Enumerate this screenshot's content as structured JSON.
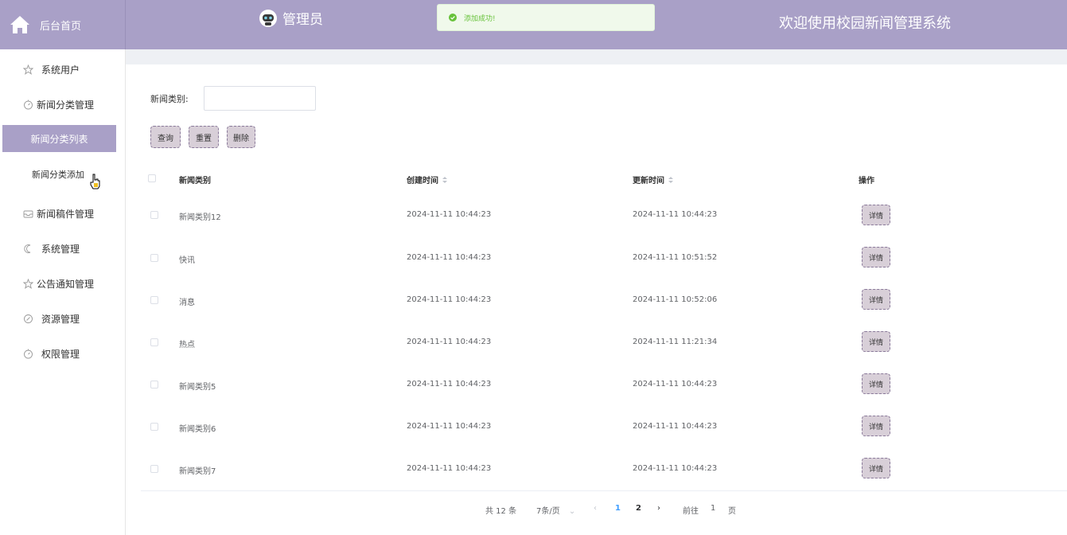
{
  "header": {
    "home_label": "后台首页",
    "admin_name": "管理员",
    "toast_message": "添加成功!",
    "welcome": "欢迎使用校园新闻管理系统"
  },
  "colors": {
    "primary": "#a9a0c7",
    "button": "#d8cfd8",
    "success": "#67c23a",
    "active_page": "#409eff"
  },
  "sidebar": {
    "items": [
      {
        "label": "系统用户",
        "icon": "star-icon"
      },
      {
        "label": "新闻分类管理",
        "icon": "timer-icon"
      },
      {
        "label": "新闻分类列表"
      },
      {
        "label": "新闻分类添加"
      },
      {
        "label": "新闻稿件管理",
        "icon": "inbox-icon"
      },
      {
        "label": "系统管理",
        "icon": "moon-icon"
      },
      {
        "label": "公告通知管理",
        "icon": "star-icon"
      },
      {
        "label": "资源管理",
        "icon": "compass-icon"
      },
      {
        "label": "权限管理",
        "icon": "timer-icon"
      }
    ]
  },
  "search": {
    "label": "新闻类别:",
    "value": "",
    "placeholder": ""
  },
  "buttons": {
    "query": "查询",
    "reset": "重置",
    "delete": "删除"
  },
  "table": {
    "headers": {
      "category": "新闻类别",
      "created": "创建时间",
      "updated": "更新时间",
      "actions": "操作"
    },
    "detail_label": "详情",
    "rows": [
      {
        "category": "新闻类别12",
        "created": "2024-11-11 10:44:23",
        "updated": "2024-11-11 10:44:23"
      },
      {
        "category": "快讯",
        "created": "2024-11-11 10:44:23",
        "updated": "2024-11-11 10:51:52"
      },
      {
        "category": "消息",
        "created": "2024-11-11 10:44:23",
        "updated": "2024-11-11 10:52:06"
      },
      {
        "category": "热点",
        "created": "2024-11-11 10:44:23",
        "updated": "2024-11-11 11:21:34"
      },
      {
        "category": "新闻类别5",
        "created": "2024-11-11 10:44:23",
        "updated": "2024-11-11 10:44:23"
      },
      {
        "category": "新闻类别6",
        "created": "2024-11-11 10:44:23",
        "updated": "2024-11-11 10:44:23"
      },
      {
        "category": "新闻类别7",
        "created": "2024-11-11 10:44:23",
        "updated": "2024-11-11 10:44:23"
      }
    ]
  },
  "pagination": {
    "total": "共 12 条",
    "page_size": "7条/页",
    "pages": [
      "1",
      "2"
    ],
    "current": "1",
    "goto_label": "前往",
    "goto_value": "1",
    "page_suffix": "页"
  }
}
